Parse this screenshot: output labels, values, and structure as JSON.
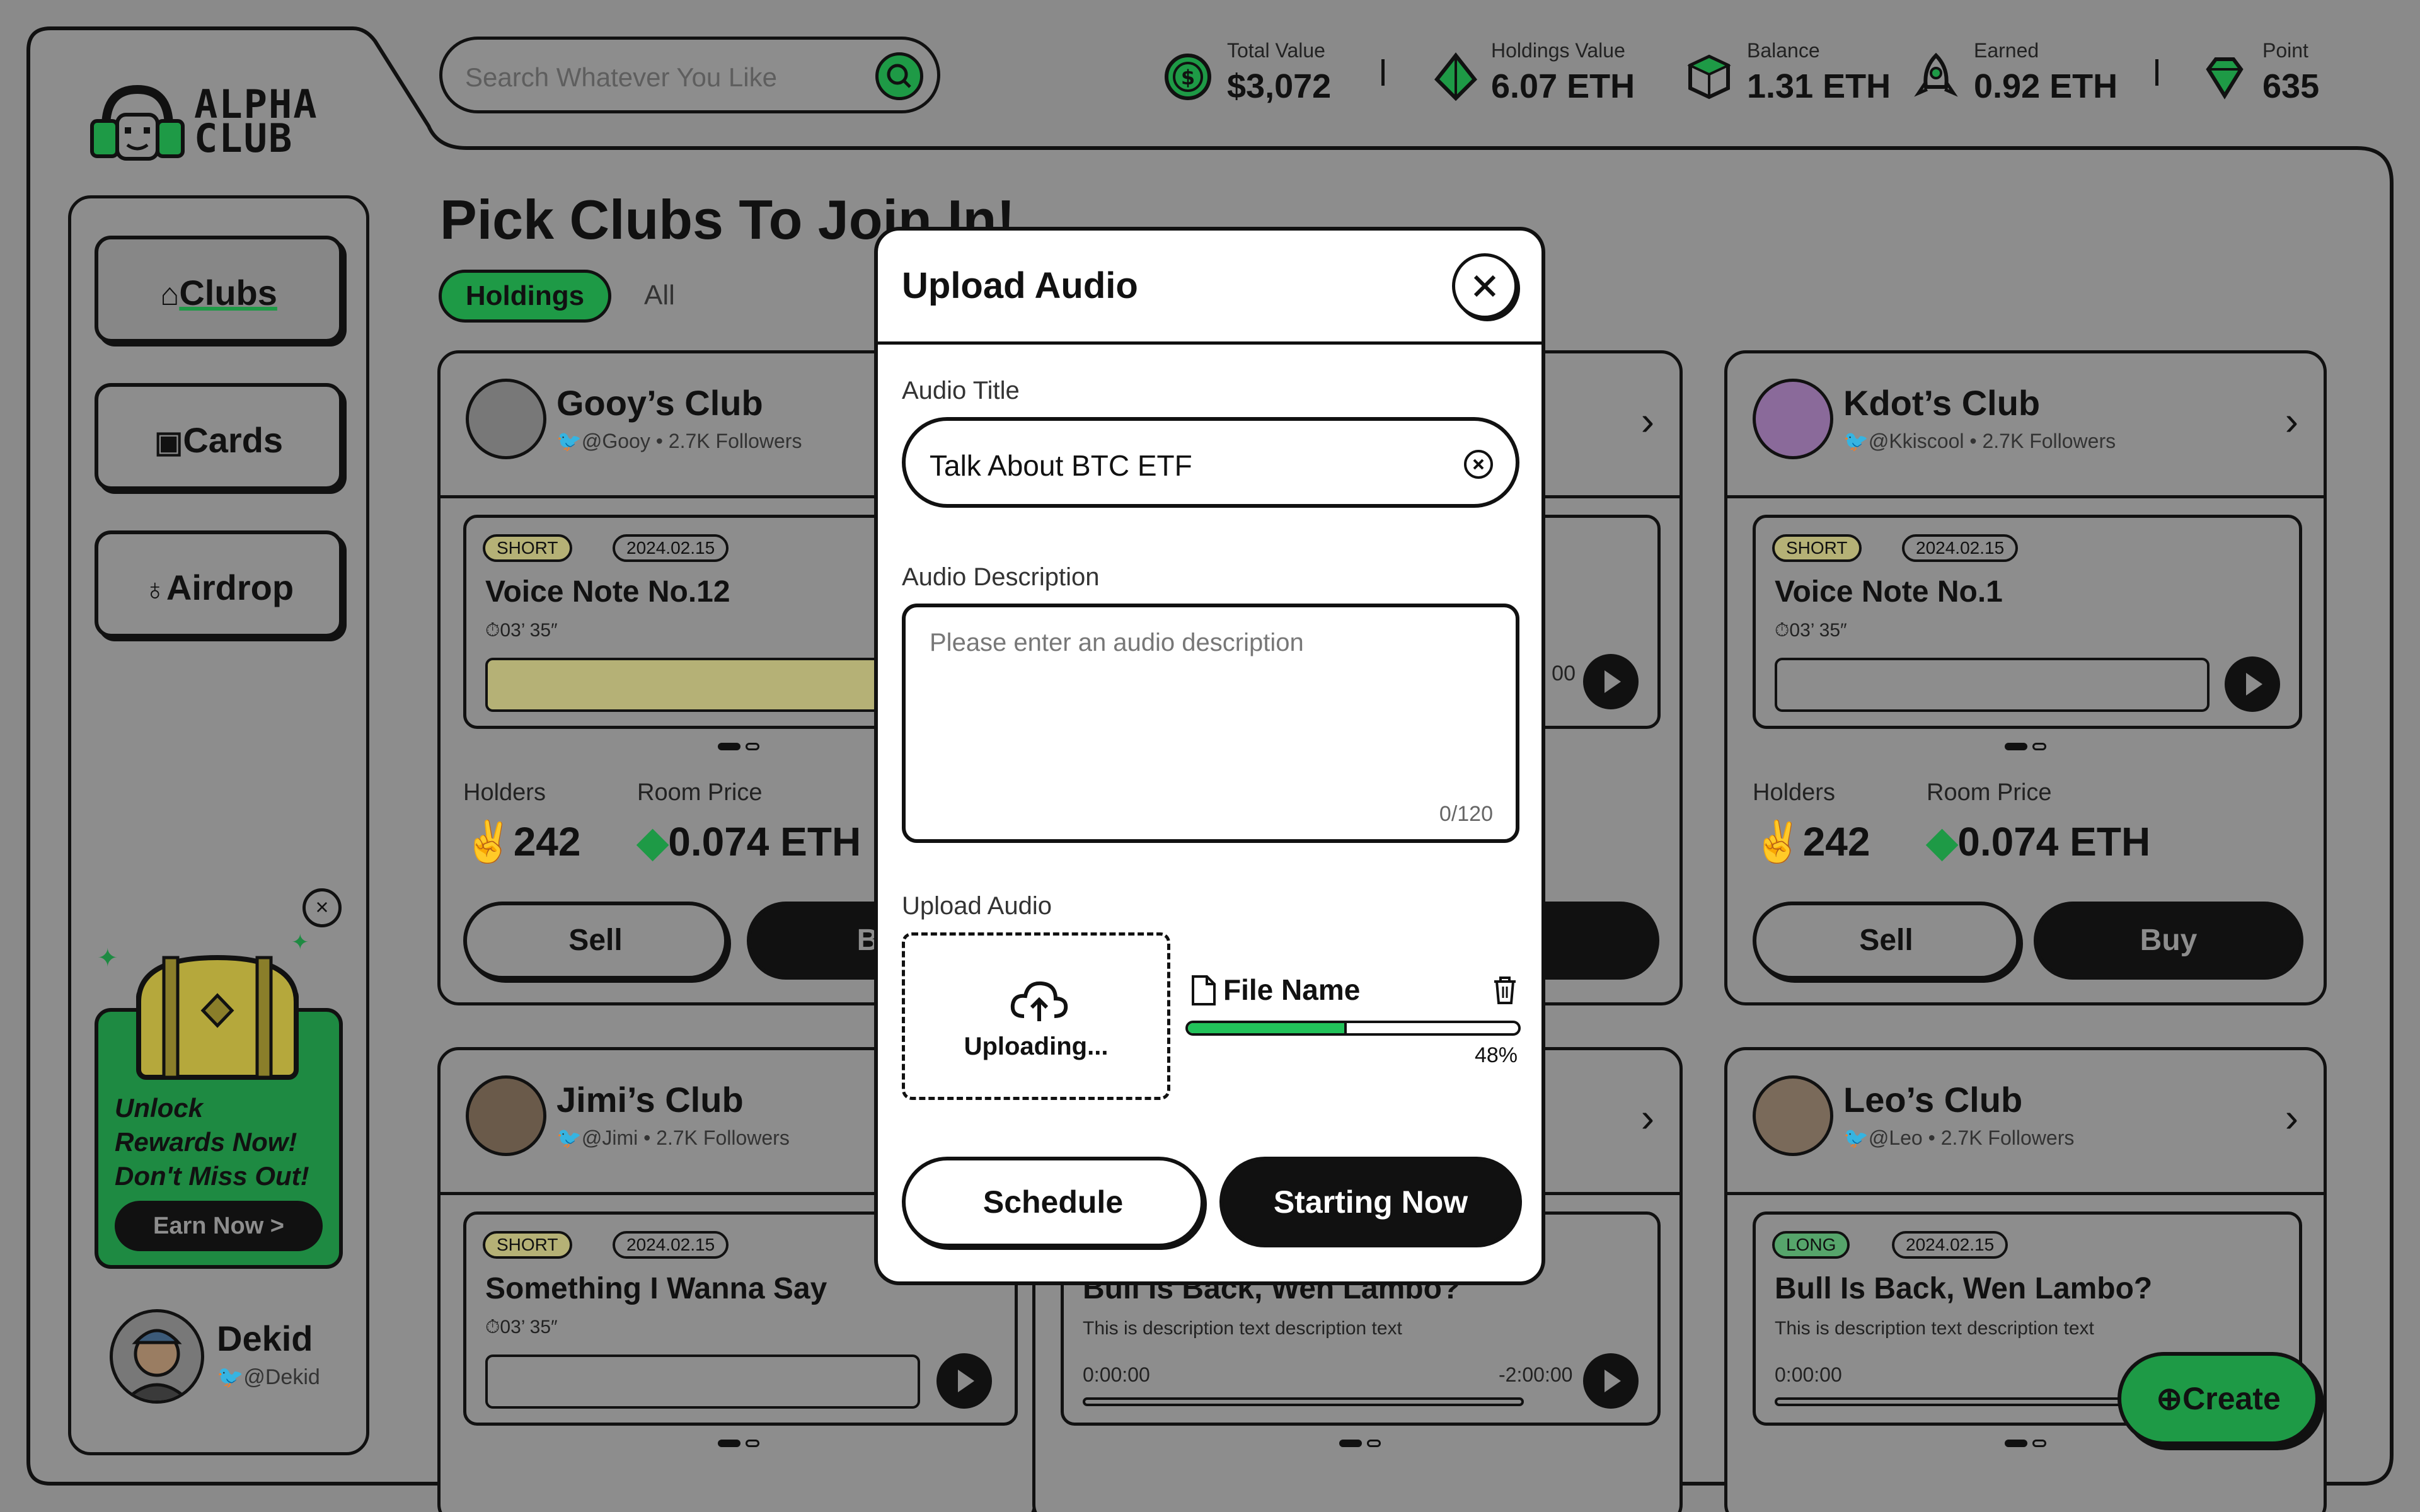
{
  "app": {
    "logo_line1": "ALPHA",
    "logo_line2": "CLUB"
  },
  "search": {
    "placeholder": "Search Whatever You Like"
  },
  "stats": [
    {
      "label": "Total Value",
      "value": "$3,072",
      "icon": "dollar-coin-icon"
    },
    {
      "label": "Holdings Value",
      "value": "6.07 ETH",
      "icon": "ethereum-icon"
    },
    {
      "label": "Balance",
      "value": "1.31 ETH",
      "icon": "cube-icon"
    },
    {
      "label": "Earned",
      "value": "0.92 ETH",
      "icon": "rocket-icon"
    },
    {
      "label": "Point",
      "value": "635",
      "icon": "diamond-icon"
    }
  ],
  "nav": {
    "clubs": "Clubs",
    "cards": "Cards",
    "airdrop": "Airdrop"
  },
  "promo": {
    "line1": "Unlock",
    "line2": "Rewards Now!",
    "line3": "Don't Miss Out!",
    "button": "Earn Now >"
  },
  "user": {
    "name": "Dekid",
    "handle": "@Dekid"
  },
  "main": {
    "title": "Pick Clubs To Join In!",
    "tabs": [
      "Holdings",
      "All"
    ]
  },
  "cards": [
    {
      "name": "Gooy’s Club",
      "handle": "@Gooy",
      "followers": "2.7K Followers",
      "tag": "SHORT",
      "date": "2024.02.15",
      "note": "Voice Note No.12",
      "duration": "03’ 35″",
      "holders_label": "Holders",
      "holders": "242",
      "price_label": "Room Price",
      "price": "0.074 ETH",
      "sell": "Sell",
      "buy": "Buy"
    },
    {
      "name": "Kdot’s Club",
      "handle": "@Kkiscool",
      "followers": "2.7K Followers",
      "tag": "SHORT",
      "date": "2024.02.15",
      "note": "Voice Note No.1",
      "duration": "03’ 35″",
      "holders_label": "Holders",
      "holders": "242",
      "price_label": "Room Price",
      "price": "0.074 ETH",
      "sell": "Sell",
      "buy": "Buy"
    },
    {
      "name": "Jimi’s Club",
      "handle": "@Jimi",
      "followers": "2.7K Followers",
      "tag": "SHORT",
      "date": "2024.02.15",
      "note": "Something I Wanna Say",
      "duration": "03’ 35″"
    },
    {
      "note": "Bull Is Back, Wen Lambo?",
      "desc": "This is description text description text",
      "time_start": "0:00:00",
      "time_end": "-2:00:00"
    },
    {
      "name": "Leo’s Club",
      "handle": "@Leo",
      "followers": "2.7K Followers",
      "tag": "LONG",
      "date": "2024.02.15",
      "note": "Bull Is Back, Wen Lambo?",
      "desc": "This is description text description text",
      "time_start": "0:00:00"
    }
  ],
  "middle_card_top": {
    "time": "00"
  },
  "create_button": "Create",
  "modal": {
    "title": "Upload Audio",
    "audio_title_label": "Audio Title",
    "audio_title_value": "Talk About BTC ETF",
    "description_label": "Audio Description",
    "description_placeholder": "Please enter an audio description",
    "description_count": "0/120",
    "upload_label": "Upload Audio",
    "uploading_text": "Uploading...",
    "file_name": "File Name",
    "progress_pct": 48,
    "progress_text": "48%",
    "schedule": "Schedule",
    "start": "Starting Now"
  },
  "colors": {
    "accent_green": "#22c25a",
    "dim_green": "#1e9a46",
    "overlay": "#8d8d8d",
    "dark": "#111111"
  }
}
